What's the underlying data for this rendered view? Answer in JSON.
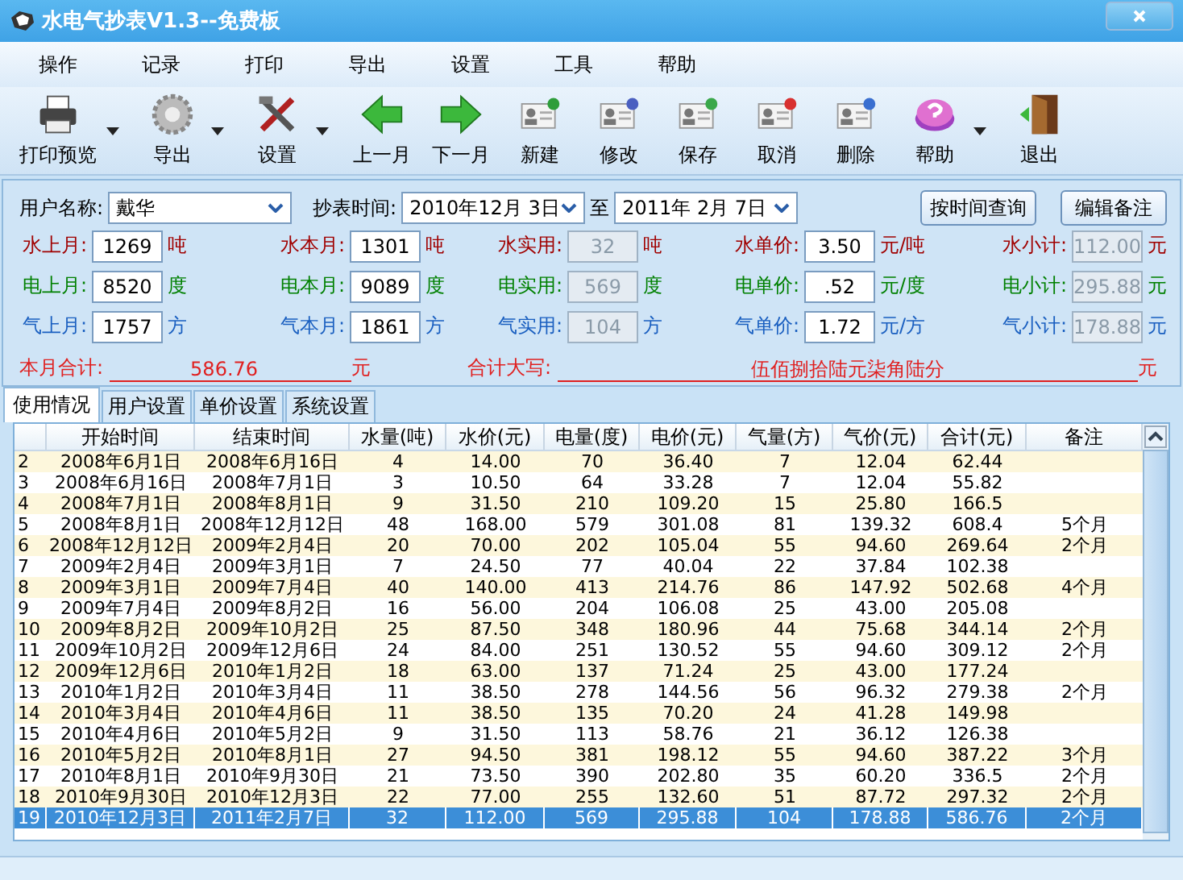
{
  "window": {
    "title": "水电气抄表V1.3--免费板"
  },
  "menu": [
    "操作",
    "记录",
    "打印",
    "导出",
    "设置",
    "工具",
    "帮助"
  ],
  "toolbar": [
    {
      "label": "打印预览",
      "kind": "printer",
      "dropdown": true
    },
    {
      "label": "导出",
      "kind": "gear",
      "dropdown": true
    },
    {
      "label": "设置",
      "kind": "tools",
      "dropdown": true
    },
    {
      "label": "上一月",
      "kind": "left",
      "dropdown": false
    },
    {
      "label": "下一月",
      "kind": "right",
      "dropdown": false
    },
    {
      "label": "新建",
      "kind": "card",
      "dropdown": false,
      "color": "#2e9d3a"
    },
    {
      "label": "修改",
      "kind": "card",
      "dropdown": false,
      "color": "#4a5fc0"
    },
    {
      "label": "保存",
      "kind": "card",
      "dropdown": false,
      "color": "#3aa84a"
    },
    {
      "label": "取消",
      "kind": "card",
      "dropdown": false,
      "color": "#d83030"
    },
    {
      "label": "删除",
      "kind": "card",
      "dropdown": false,
      "color": "#3a6fd0"
    },
    {
      "label": "帮助",
      "kind": "help",
      "dropdown": true
    },
    {
      "label": "退出",
      "kind": "exit",
      "dropdown": false
    }
  ],
  "query": {
    "user_label": "用户名称:",
    "user": "戴华",
    "date_label": "抄表时间:",
    "from": "2010年12月 3日",
    "to_label": "至",
    "to": "2011年 2月 7日",
    "buttons": [
      "按时间查询",
      "编辑备注"
    ]
  },
  "meters": [
    {
      "color": "#a00000",
      "fields": [
        {
          "label": "水上月:",
          "value": "1269",
          "unit": "吨",
          "disabled": false
        },
        {
          "label": "水本月:",
          "value": "1301",
          "unit": "吨",
          "disabled": false
        },
        {
          "label": "水实用:",
          "value": "32",
          "unit": "吨",
          "disabled": true
        },
        {
          "label": "水单价:",
          "value": "3.50",
          "unit": "元/吨",
          "disabled": false
        },
        {
          "label": "水小计:",
          "value": "112.00",
          "unit": "元",
          "disabled": true
        }
      ]
    },
    {
      "color": "#008000",
      "fields": [
        {
          "label": "电上月:",
          "value": "8520",
          "unit": "度",
          "disabled": false
        },
        {
          "label": "电本月:",
          "value": "9089",
          "unit": "度",
          "disabled": false
        },
        {
          "label": "电实用:",
          "value": "569",
          "unit": "度",
          "disabled": true
        },
        {
          "label": "电单价:",
          "value": ".52",
          "unit": "元/度",
          "disabled": false
        },
        {
          "label": "电小计:",
          "value": "295.88",
          "unit": "元",
          "disabled": true
        }
      ]
    },
    {
      "color": "#1a5fc0",
      "fields": [
        {
          "label": "气上月:",
          "value": "1757",
          "unit": "方",
          "disabled": false
        },
        {
          "label": "气本月:",
          "value": "1861",
          "unit": "方",
          "disabled": false
        },
        {
          "label": "气实用:",
          "value": "104",
          "unit": "方",
          "disabled": true
        },
        {
          "label": "气单价:",
          "value": "1.72",
          "unit": "元/方",
          "disabled": false
        },
        {
          "label": "气小计:",
          "value": "178.88",
          "unit": "元",
          "disabled": true
        }
      ]
    }
  ],
  "totals": {
    "month_label": "本月合计:",
    "month": "586.76",
    "month_unit": "元",
    "words_label": "合计大写:",
    "words": "伍佰捌拾陆元柒角陆分",
    "words_unit": "元"
  },
  "tabs": [
    {
      "label": "使用情况",
      "selected": true
    },
    {
      "label": "用户设置",
      "selected": false
    },
    {
      "label": "单价设置",
      "selected": false
    },
    {
      "label": "系统设置",
      "selected": false
    }
  ],
  "table": {
    "columns": [
      "",
      "开始时间",
      "结束时间",
      "水量(吨)",
      "水价(元)",
      "电量(度)",
      "电价(元)",
      "气量(方)",
      "气价(元)",
      "合计(元)",
      "备注"
    ],
    "rows": [
      {
        "cells": [
          "2",
          "2008年6月1日",
          "2008年6月16日",
          "4",
          "14.00",
          "70",
          "36.40",
          "7",
          "12.04",
          "62.44",
          ""
        ],
        "selected": false
      },
      {
        "cells": [
          "3",
          "2008年6月16日",
          "2008年7月1日",
          "3",
          "10.50",
          "64",
          "33.28",
          "7",
          "12.04",
          "55.82",
          ""
        ],
        "selected": false
      },
      {
        "cells": [
          "4",
          "2008年7月1日",
          "2008年8月1日",
          "9",
          "31.50",
          "210",
          "109.20",
          "15",
          "25.80",
          "166.5",
          ""
        ],
        "selected": false
      },
      {
        "cells": [
          "5",
          "2008年8月1日",
          "2008年12月12日",
          "48",
          "168.00",
          "579",
          "301.08",
          "81",
          "139.32",
          "608.4",
          "5个月"
        ],
        "selected": false
      },
      {
        "cells": [
          "6",
          "2008年12月12日",
          "2009年2月4日",
          "20",
          "70.00",
          "202",
          "105.04",
          "55",
          "94.60",
          "269.64",
          "2个月"
        ],
        "selected": false
      },
      {
        "cells": [
          "7",
          "2009年2月4日",
          "2009年3月1日",
          "7",
          "24.50",
          "77",
          "40.04",
          "22",
          "37.84",
          "102.38",
          ""
        ],
        "selected": false
      },
      {
        "cells": [
          "8",
          "2009年3月1日",
          "2009年7月4日",
          "40",
          "140.00",
          "413",
          "214.76",
          "86",
          "147.92",
          "502.68",
          "4个月"
        ],
        "selected": false
      },
      {
        "cells": [
          "9",
          "2009年7月4日",
          "2009年8月2日",
          "16",
          "56.00",
          "204",
          "106.08",
          "25",
          "43.00",
          "205.08",
          ""
        ],
        "selected": false
      },
      {
        "cells": [
          "10",
          "2009年8月2日",
          "2009年10月2日",
          "25",
          "87.50",
          "348",
          "180.96",
          "44",
          "75.68",
          "344.14",
          "2个月"
        ],
        "selected": false
      },
      {
        "cells": [
          "11",
          "2009年10月2日",
          "2009年12月6日",
          "24",
          "84.00",
          "251",
          "130.52",
          "55",
          "94.60",
          "309.12",
          "2个月"
        ],
        "selected": false
      },
      {
        "cells": [
          "12",
          "2009年12月6日",
          "2010年1月2日",
          "18",
          "63.00",
          "137",
          "71.24",
          "25",
          "43.00",
          "177.24",
          ""
        ],
        "selected": false
      },
      {
        "cells": [
          "13",
          "2010年1月2日",
          "2010年3月4日",
          "11",
          "38.50",
          "278",
          "144.56",
          "56",
          "96.32",
          "279.38",
          "2个月"
        ],
        "selected": false
      },
      {
        "cells": [
          "14",
          "2010年3月4日",
          "2010年4月6日",
          "11",
          "38.50",
          "135",
          "70.20",
          "24",
          "41.28",
          "149.98",
          ""
        ],
        "selected": false
      },
      {
        "cells": [
          "15",
          "2010年4月6日",
          "2010年5月2日",
          "9",
          "31.50",
          "113",
          "58.76",
          "21",
          "36.12",
          "126.38",
          ""
        ],
        "selected": false
      },
      {
        "cells": [
          "16",
          "2010年5月2日",
          "2010年8月1日",
          "27",
          "94.50",
          "381",
          "198.12",
          "55",
          "94.60",
          "387.22",
          "3个月"
        ],
        "selected": false
      },
      {
        "cells": [
          "17",
          "2010年8月1日",
          "2010年9月30日",
          "21",
          "73.50",
          "390",
          "202.80",
          "35",
          "60.20",
          "336.5",
          "2个月"
        ],
        "selected": false
      },
      {
        "cells": [
          "18",
          "2010年9月30日",
          "2010年12月3日",
          "22",
          "77.00",
          "255",
          "132.60",
          "51",
          "87.72",
          "297.32",
          "2个月"
        ],
        "selected": false
      },
      {
        "cells": [
          "19",
          "2010年12月3日",
          "2011年2月7日",
          "32",
          "112.00",
          "569",
          "295.88",
          "104",
          "178.88",
          "586.76",
          "2个月"
        ],
        "selected": true
      }
    ]
  }
}
